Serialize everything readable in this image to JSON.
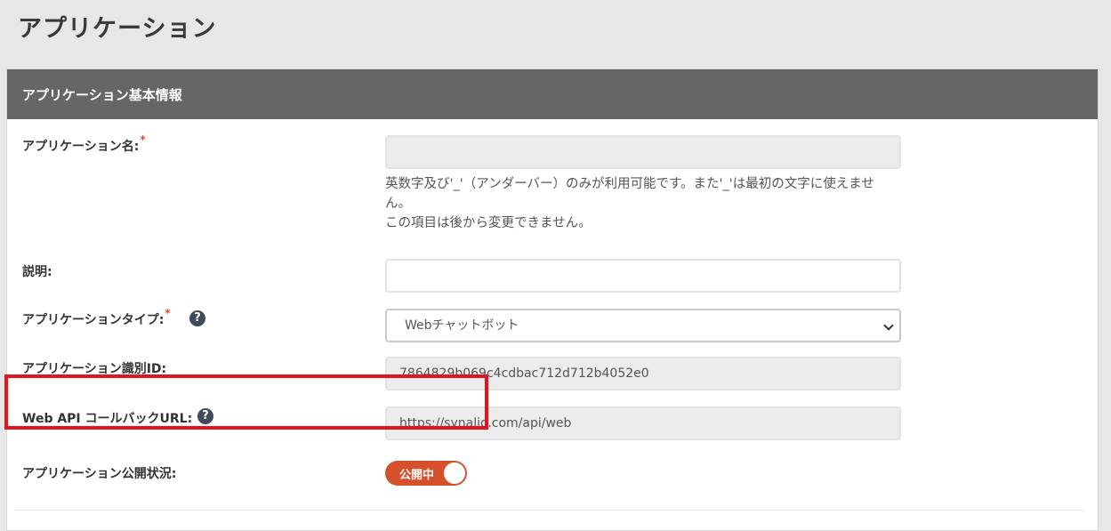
{
  "page": {
    "title": "アプリケーション"
  },
  "panel": {
    "title": "アプリケーション基本情報"
  },
  "fields": {
    "app_name": {
      "label": "アプリケーション名:",
      "required": "*",
      "value": "",
      "help_line1": "英数字及び'_'（アンダーバー）のみが利用可能です。また'_'は最初の文字に使えません。",
      "help_line2": "この項目は後から変更できません。"
    },
    "description": {
      "label": "説明:",
      "value": ""
    },
    "app_type": {
      "label": "アプリケーションタイプ:",
      "required": "*",
      "selected": "Webチャットボット",
      "help_icon": "question-circle-icon"
    },
    "app_id": {
      "label": "アプリケーション識別ID:",
      "value": "7864829b069c4cdbac712d712b4052e0"
    },
    "callback_url": {
      "label": "Web API コールバックURL:",
      "value": "https://synalio.com/api/web",
      "help_icon": "question-circle-icon"
    },
    "publish_status": {
      "label": "アプリケーション公開状況:",
      "toggle_label": "公開中",
      "state": "on"
    }
  },
  "colors": {
    "header_bg": "#666666",
    "toggle_on": "#d6502c",
    "highlight": "#e3141f",
    "required": "#e04b2a"
  }
}
